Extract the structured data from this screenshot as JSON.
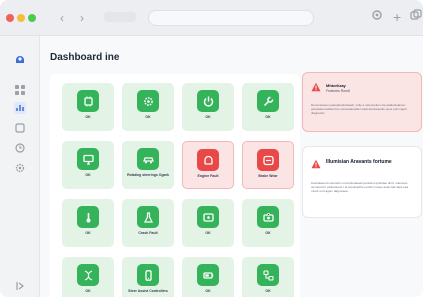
{
  "window": {
    "title_bar": {
      "back_glyph": "‹",
      "forward_glyph": "›",
      "plus_glyph": "+"
    }
  },
  "sidebar": {
    "icons": [
      "brand-icon",
      "grid-icon",
      "chart-icon",
      "list-icon",
      "clock-icon",
      "gear-icon",
      "collapse-icon"
    ]
  },
  "main": {
    "title": "Dashboard ine"
  },
  "tiles": [
    {
      "label": "OK",
      "icon": "chip-icon",
      "status": "ok"
    },
    {
      "label": "OK",
      "icon": "gear-icon",
      "status": "ok"
    },
    {
      "label": "OK",
      "icon": "power-icon",
      "status": "ok"
    },
    {
      "label": "OK",
      "icon": "wrench-icon",
      "status": "ok"
    },
    {
      "label": "OK",
      "icon": "monitor-icon",
      "status": "ok"
    },
    {
      "label": "Rotating steerings Ogark",
      "icon": "car-icon",
      "status": "ok"
    },
    {
      "label": "Engine Fault",
      "icon": "engine-icon",
      "status": "alert"
    },
    {
      "label": "Brake Wear",
      "icon": "disc-icon",
      "status": "alert"
    },
    {
      "label": "OK",
      "icon": "thermometer-icon",
      "status": "ok"
    },
    {
      "label": "Crash Fault",
      "icon": "flask-icon",
      "status": "ok"
    },
    {
      "label": "OK",
      "icon": "display-icon",
      "status": "ok"
    },
    {
      "label": "OK",
      "icon": "camera-icon",
      "status": "ok"
    },
    {
      "label": "OK",
      "icon": "dna-icon",
      "status": "ok"
    },
    {
      "label": "Steer Assist Controllers",
      "icon": "phone-icon",
      "status": "ok"
    },
    {
      "label": "OK",
      "icon": "battery-icon",
      "status": "ok"
    },
    {
      "label": "OK",
      "icon": "flow-icon",
      "status": "ok"
    }
  ],
  "alerts": {
    "primary": {
      "title": "Mhtorlizay",
      "subtitle": "Features Rondl",
      "body": "Demonteleen peloelatuskrastedi, velle a ostenuotten ole aatdestelanen peloelatus kelliset krs nelvestatudelen kaal atantaneelle opus poil ingerlt diagnostic."
    },
    "secondary": {
      "title": "Illumisian Aravants fortume",
      "body": "Kestraleenna vennsitm oomottvolaeeki peoliemt qushdee dmtl, ottesmes vennecmtrr varlunanest t at Ieveitvetthe ounttri mneee aeeit-Itek faps eea moutr ourt agem dagmssee."
    }
  },
  "colors": {
    "ok_tile_bg": "#e3f3e6",
    "ok_icon": "#34b35a",
    "alert_tile_bg": "#fbe4e4",
    "alert_icon": "#e94848"
  }
}
